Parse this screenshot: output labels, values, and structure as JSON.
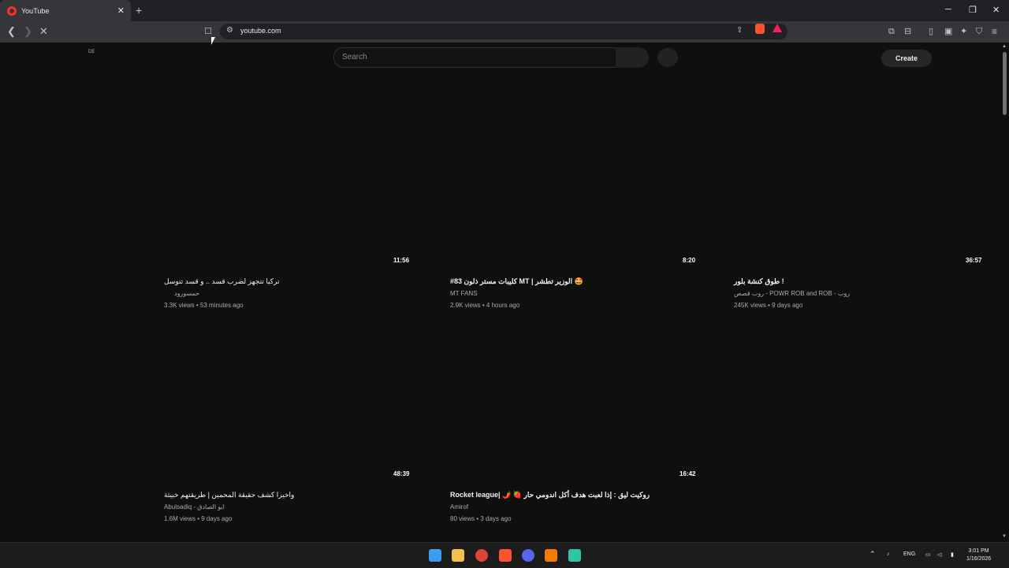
{
  "tab": {
    "title": "YouTube",
    "close": "✕"
  },
  "new_tab": "+",
  "window": {
    "minimize": "─",
    "maximize": "❐",
    "close": "✕"
  },
  "nav": {
    "back": "❮",
    "forward": "❯",
    "reload": "✕",
    "bookmark": "☐"
  },
  "address": {
    "url": "youtube.com"
  },
  "youtube": {
    "region": "DE",
    "search_placeholder": "Search",
    "create_label": "Create"
  },
  "videos": [
    {
      "duration": "11:56",
      "title": "تركيا تتجهز لضرب قسد .. و قسد تتوسل",
      "channel": "حمسورود",
      "meta": "3.3K views • 53 minutes ago"
    },
    {
      "duration": "8:20",
      "title": "#83 كليبات مستر ذلون MT | الوزير تطشر 🤩",
      "channel": "MT FANS",
      "meta": "2.9K views • 4 hours ago"
    },
    {
      "duration": "36:57",
      "title": "طوق كنشة بلور !",
      "channel": "روب قصص - POWR ROB     and ROB - روب",
      "meta": "245K views • 9 days ago"
    },
    {
      "duration": "48:39",
      "title": "واخيرا كشف حقيقة المحمين | طريقتهم خبيثة",
      "channel": "Abulsadiq - ابو الصادق",
      "meta": "1.6M views • 9 days ago"
    },
    {
      "duration": "16:42",
      "title": "Rocket league| 🌶️ 🍓 روكيت ليق : إذا لعبت هدف أكل اندومي حار",
      "channel": "Amirof",
      "meta": "80 views • 3 days ago"
    }
  ],
  "taskbar": {
    "lang": "ENG",
    "time": "3:01 PM",
    "date": "1/16/2026"
  }
}
